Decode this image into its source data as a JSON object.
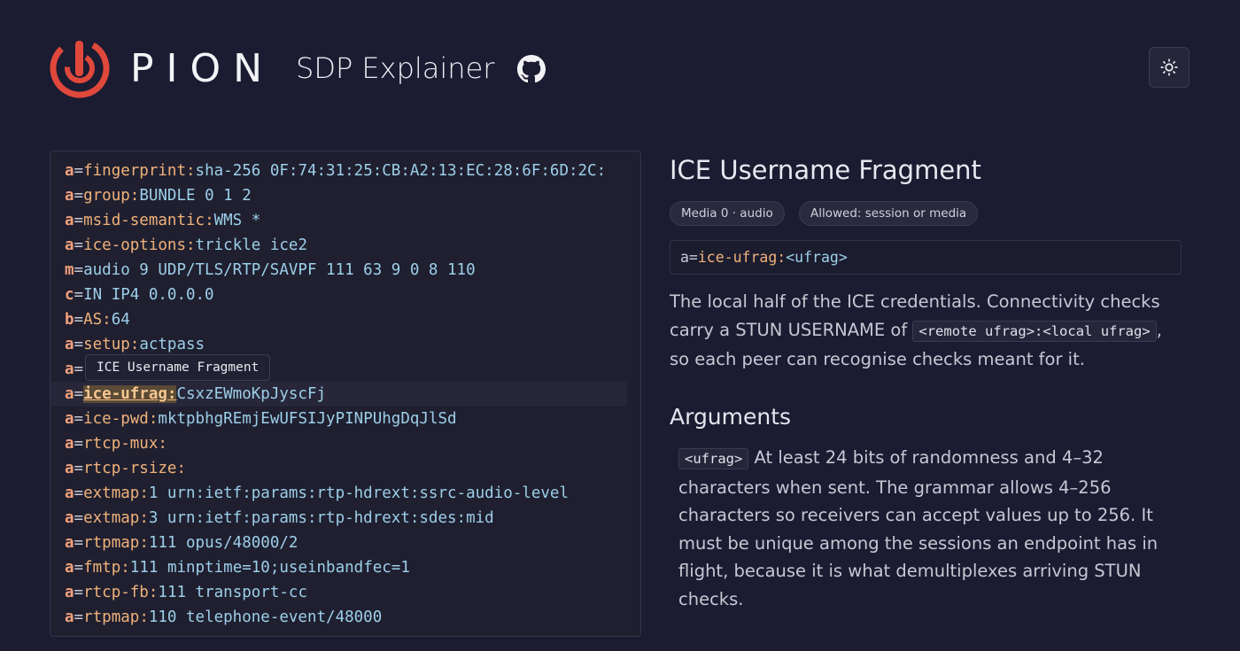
{
  "header": {
    "logo_text": "PION",
    "app_title": "SDP Explainer",
    "github_icon": "github-icon",
    "theme_icon": "sun-icon"
  },
  "sdp_lines": [
    {
      "type": "a",
      "attr": "fingerprint",
      "value": "sha-256 0F:74:31:25:CB:A2:13:EC:28:6F:6D:2C:"
    },
    {
      "type": "a",
      "attr": "group",
      "value": "BUNDLE 0 1 2"
    },
    {
      "type": "a",
      "attr": "msid-semantic",
      "value": "WMS *"
    },
    {
      "type": "a",
      "attr": "ice-options",
      "value": "trickle ice2"
    },
    {
      "type": "m",
      "attr": "",
      "value": "audio 9 UDP/TLS/RTP/SAVPF 111 63 9 0 8 110"
    },
    {
      "type": "c",
      "attr": "",
      "value": "IN IP4 0.0.0.0"
    },
    {
      "type": "b",
      "attr": "AS",
      "value": "64"
    },
    {
      "type": "a",
      "attr": "setup",
      "value": "actpass"
    },
    {
      "type": "a",
      "attr": "",
      "value": ""
    },
    {
      "type": "a",
      "attr": "ice-ufrag",
      "value": "CsxzEWmoKpJyscFj",
      "active": true
    },
    {
      "type": "a",
      "attr": "ice-pwd",
      "value": "mktpbhgREmjEwUFSIJyPINPUhgDqJlSd"
    },
    {
      "type": "a",
      "attr": "rtcp-mux",
      "value": ""
    },
    {
      "type": "a",
      "attr": "rtcp-rsize",
      "value": ""
    },
    {
      "type": "a",
      "attr": "extmap",
      "value": "1 urn:ietf:params:rtp-hdrext:ssrc-audio-level"
    },
    {
      "type": "a",
      "attr": "extmap",
      "value": "3 urn:ietf:params:rtp-hdrext:sdes:mid"
    },
    {
      "type": "a",
      "attr": "rtpmap",
      "value": "111 opus/48000/2"
    },
    {
      "type": "a",
      "attr": "fmtp",
      "value": "111 minptime=10;useinbandfec=1"
    },
    {
      "type": "a",
      "attr": "rtcp-fb",
      "value": "111 transport-cc"
    },
    {
      "type": "a",
      "attr": "rtpmap",
      "value": "110 telephone-event/48000"
    }
  ],
  "tooltip": "ICE Username Fragment",
  "detail": {
    "title": "ICE Username Fragment",
    "chip_scope": "Media 0 · audio",
    "chip_allowed": "Allowed: session or media",
    "syntax_prefix": "a=",
    "syntax_attr": "ice-ufrag",
    "syntax_colon": ":",
    "syntax_arg": "<ufrag>",
    "desc_before": "The local half of the ICE credentials. Connectivity checks carry a STUN USERNAME of ",
    "desc_code": "<remote ufrag>:<local ufrag>",
    "desc_after": ", so each peer can recognise checks meant for it.",
    "args_heading": "Arguments",
    "arg_code": "<ufrag>",
    "arg_text": " At least 24 bits of randomness and 4–32 characters when sent. The grammar allows 4–256 characters so receivers can accept values up to 256. It must be unique among the sessions an endpoint has in flight, because it is what demultiplexes arriving STUN checks."
  },
  "colors": {
    "background": "#1b1b31",
    "accent": "#e0483b",
    "attr": "#f0b27a",
    "value": "#9ccfe8"
  }
}
